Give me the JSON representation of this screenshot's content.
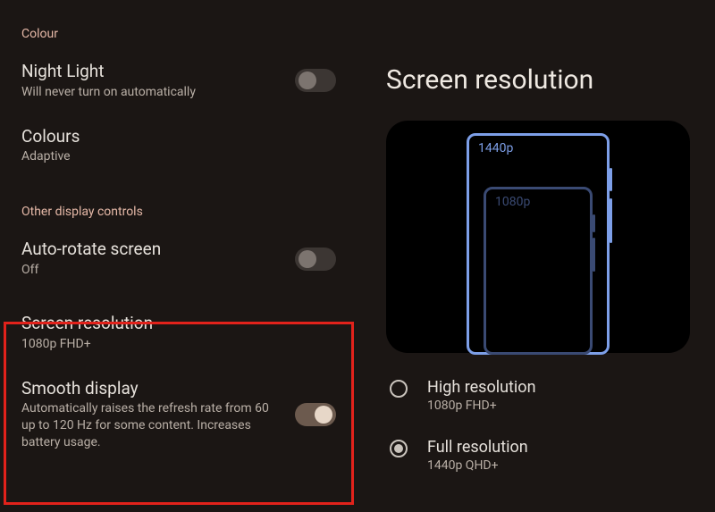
{
  "left": {
    "section_colour": "Colour",
    "night_light": {
      "title": "Night Light",
      "sub": "Will never turn on automatically",
      "on": false
    },
    "colours": {
      "title": "Colours",
      "sub": "Adaptive"
    },
    "section_other": "Other display controls",
    "auto_rotate": {
      "title": "Auto-rotate screen",
      "sub": "Off",
      "on": false
    },
    "screen_res": {
      "title": "Screen resolution",
      "sub": "1080p FHD+"
    },
    "smooth": {
      "title": "Smooth display",
      "sub": "Automatically raises the refresh rate from 60 up to 120 Hz for some content. Increases battery usage.",
      "on": true
    }
  },
  "right": {
    "title": "Screen resolution",
    "illus": {
      "big_label": "1440p",
      "small_label": "1080p"
    },
    "options": [
      {
        "title": "High resolution",
        "sub": "1080p FHD+",
        "checked": false
      },
      {
        "title": "Full resolution",
        "sub": "1440p QHD+",
        "checked": true
      }
    ]
  }
}
